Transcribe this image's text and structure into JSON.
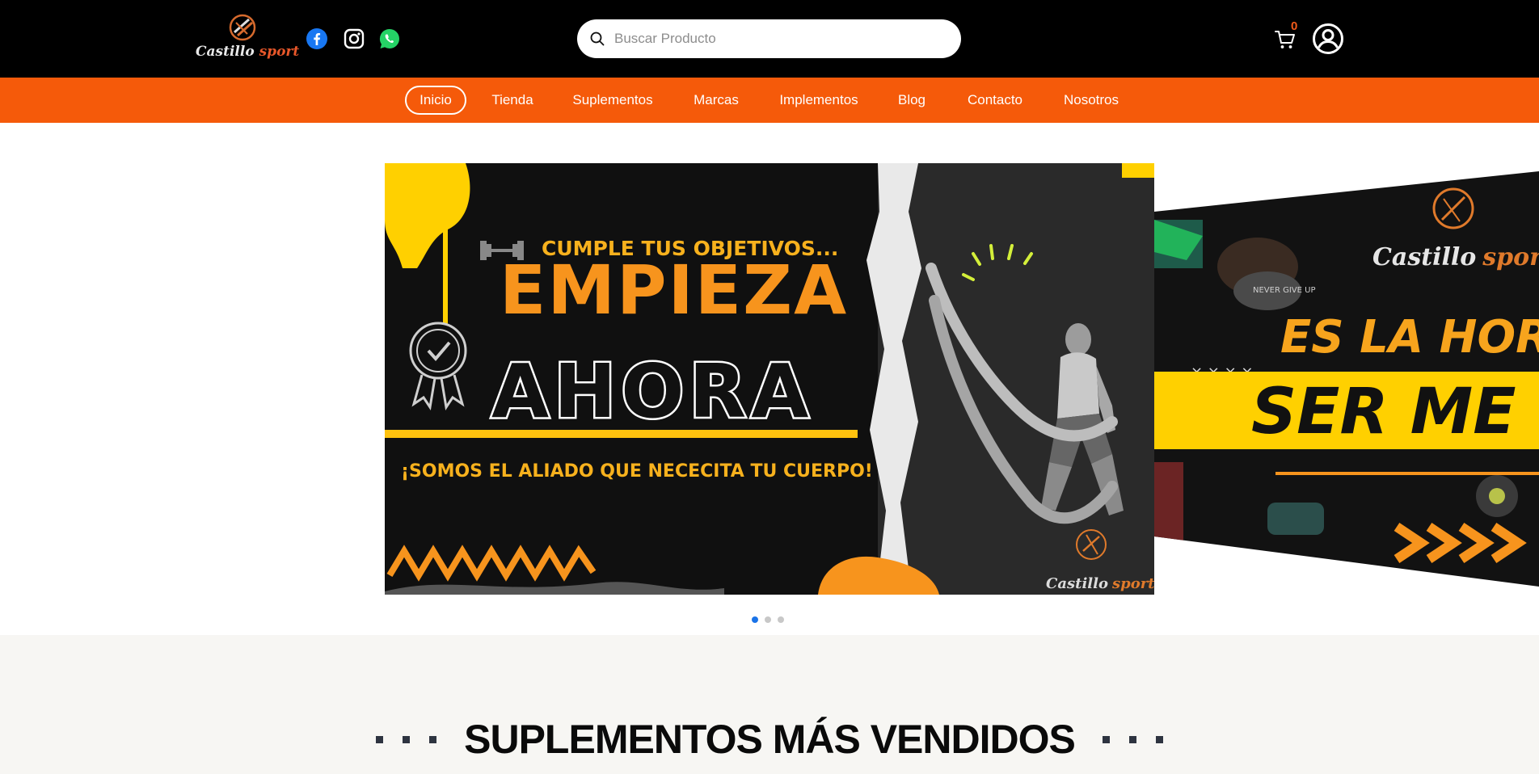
{
  "brand": {
    "name_part1": "Castillo",
    "name_part2": "sport"
  },
  "social": [
    {
      "name": "facebook-icon"
    },
    {
      "name": "instagram-icon"
    },
    {
      "name": "whatsapp-icon"
    }
  ],
  "search": {
    "placeholder": "Buscar Producto"
  },
  "cart": {
    "count": "0"
  },
  "nav": {
    "items": [
      {
        "label": "Inicio",
        "active": true
      },
      {
        "label": "Tienda"
      },
      {
        "label": "Suplementos"
      },
      {
        "label": "Marcas"
      },
      {
        "label": "Implementos"
      },
      {
        "label": "Blog"
      },
      {
        "label": "Contacto"
      },
      {
        "label": "Nosotros"
      }
    ]
  },
  "banner_main": {
    "tagline": "CUMPLE TUS OBJETIVOS...",
    "headline1": "EMPIEZA",
    "headline2": "AHORA",
    "slogan": "¡SOMOS EL ALIADO QUE NECECITA TU CUERPO!",
    "logo_part1": "Castillo",
    "logo_part2": "sport"
  },
  "banner_next": {
    "logo_part1": "Castillo",
    "logo_part2": "sport",
    "line1": "ES LA HOR",
    "line2": "SER ME",
    "xs": "× × × ×",
    "badge": "NEVER GIVE UP"
  },
  "slider": {
    "total_dots": 3,
    "active": 0
  },
  "section": {
    "title": "SUPLEMENTOS MÁS VENDIDOS"
  },
  "colors": {
    "accent": "#f55a0a",
    "header": "#000000",
    "banner_orange": "#f7941d",
    "banner_yellow": "#ffd000"
  }
}
